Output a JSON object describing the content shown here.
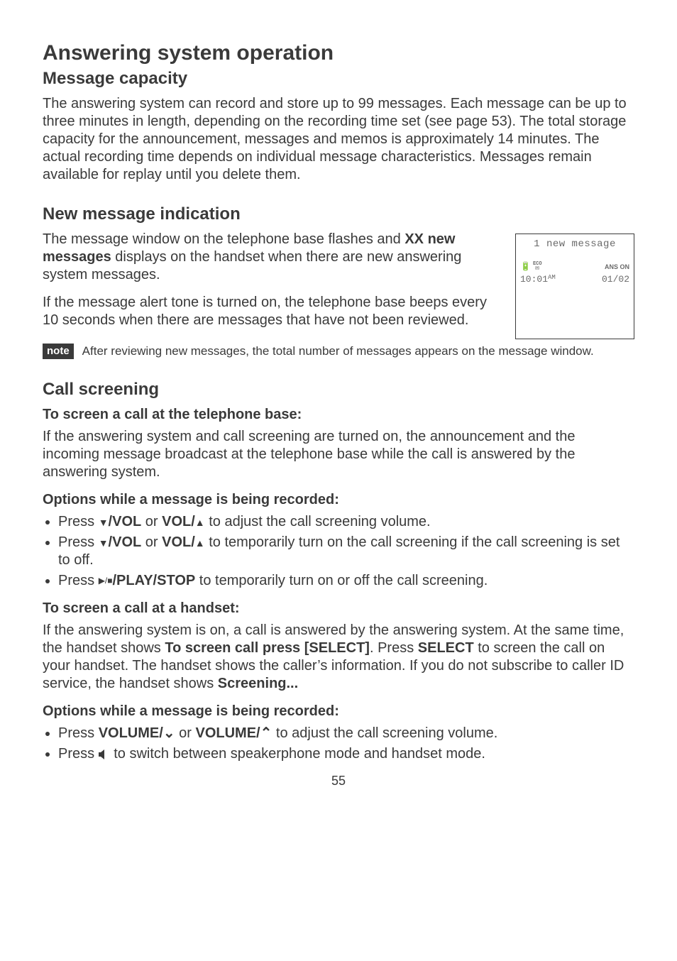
{
  "title": "Answering system operation",
  "s1": {
    "heading": "Message capacity",
    "p": "The answering system can record and store up to 99 messages. Each message can be up to three minutes in length, depending on the recording time set (see page 53). The total storage capacity for the announcement, messages and memos is approximately 14 minutes. The actual recording time depends on individual message characteristics. Messages remain available for replay until you delete them."
  },
  "s2": {
    "heading": "New message indication",
    "p1a": "The message window on the telephone base flashes and ",
    "p1b": "XX new messages",
    "p1c": " displays on the handset when there are new answering system messages.",
    "p2": "If the message alert tone is turned on, the telephone base beeps every 10 seconds when there are messages that have not been reviewed.",
    "screen": {
      "top": "1 new message",
      "eco": "ECO",
      "anson": "ANS ON",
      "time": "10:01",
      "ampm": "AM",
      "date": "01/02"
    },
    "note_label": "note",
    "note_text": "After reviewing new messages, the total number of messages appears on the message window."
  },
  "s3": {
    "heading": "Call screening",
    "sub1": "To screen a call at the telephone base:",
    "p1": "If the answering system and call screening are turned on, the announcement and the incoming message broadcast at the telephone base while the call is answered by the answering system.",
    "sub2": "Options while a message is being recorded:",
    "li1a": "Press ",
    "li1_vol1": "/VOL",
    "li1_or": " or ",
    "li1_vol2": "VOL/",
    "li1b": " to adjust the call screening volume.",
    "li2a": "Press ",
    "li2_vol1": "/VOL",
    "li2_or": " or ",
    "li2_vol2": "VOL/",
    "li2b": " to temporarily turn on the call screening if the call screening is set to off.",
    "li3a": "Press ",
    "li3_play_icon": "▶/■",
    "li3_play": "/PLAY/STOP",
    "li3b": " to temporarily turn on or off the call screening.",
    "sub3": "To screen a call at a handset:",
    "p2a": "If the answering system is on, a call is answered by the answering system. At the same time, the handset shows ",
    "p2b": "To screen call press [SELECT]",
    "p2c": ". Press ",
    "p2d": "SELECT",
    "p2e": " to screen the call on your handset. The handset shows the caller’s information. If you do not subscribe to caller ID service, the handset shows ",
    "p2f": "Screening...",
    "sub4": "Options while a message is being recorded:",
    "li4a": "Press ",
    "li4_vol1": "VOLUME/",
    "li4_or": " or ",
    "li4_vol2": "VOLUME/",
    "li4b": " to adjust the call screening volume.",
    "li5a": "Press ",
    "li5_icon": "◀",
    "li5b": " to switch between speakerphone mode and handset mode."
  },
  "page": "55"
}
